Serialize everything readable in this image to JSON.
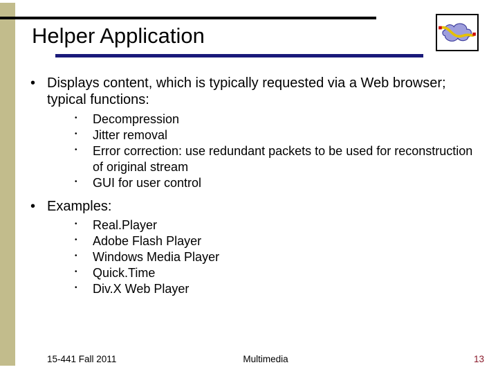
{
  "title": "Helper Application",
  "bullets": [
    {
      "text": "Displays content, which is typically requested via a Web browser; typical functions:",
      "sub": [
        "Decompression",
        "Jitter removal",
        "Error correction: use redundant packets to be used for reconstruction of original stream",
        "GUI for user control"
      ]
    },
    {
      "text": "Examples:",
      "sub": [
        "Real.Player",
        "Adobe Flash Player",
        "Windows Media Player",
        "Quick.Time",
        "Div.X Web Player"
      ]
    }
  ],
  "footer": {
    "course": "15-441 Fall 2011",
    "topic": "Multimedia",
    "page": "13"
  },
  "logo_name": "network-cloud-icon"
}
